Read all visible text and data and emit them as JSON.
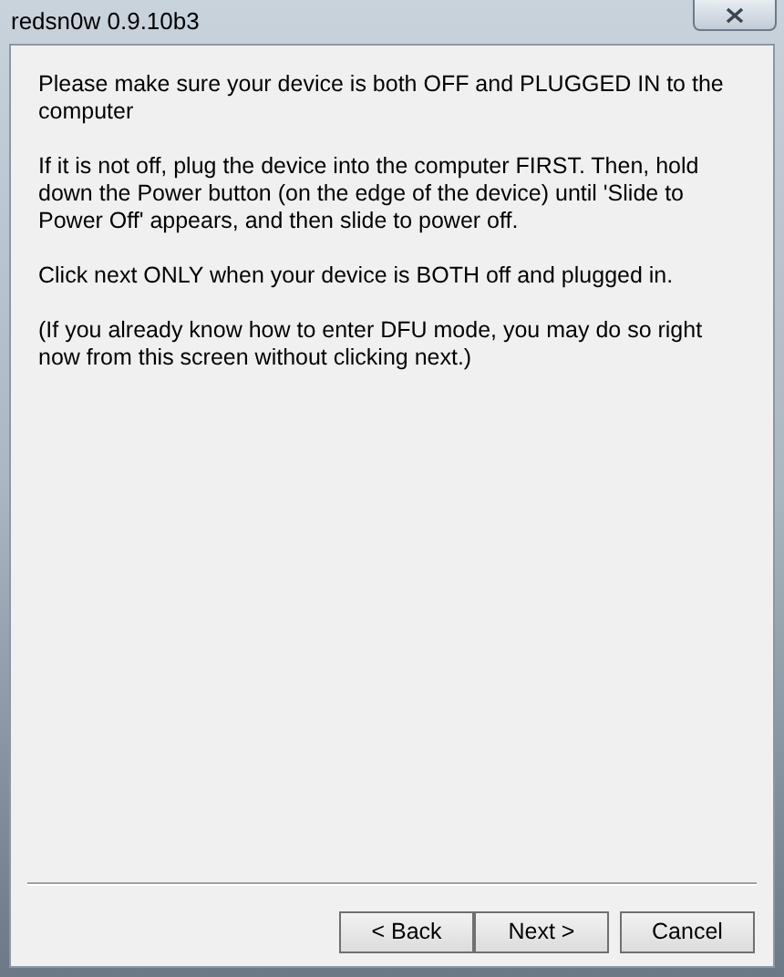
{
  "window": {
    "title": "redsn0w 0.9.10b3"
  },
  "paragraphs": [
    "Please make sure your device is both OFF and PLUGGED IN to the computer",
    "If it is not off, plug the device into the computer FIRST. Then, hold down the Power button (on the edge of the device) until 'Slide to Power Off' appears, and then slide to power off.",
    "Click next ONLY when your device is BOTH off and plugged in.",
    "(If you already know how to enter DFU mode, you may do so right now from this screen without clicking next.)"
  ],
  "buttons": [
    {
      "label": "< Back"
    },
    {
      "label": "Next >"
    },
    {
      "label": "Cancel"
    }
  ]
}
